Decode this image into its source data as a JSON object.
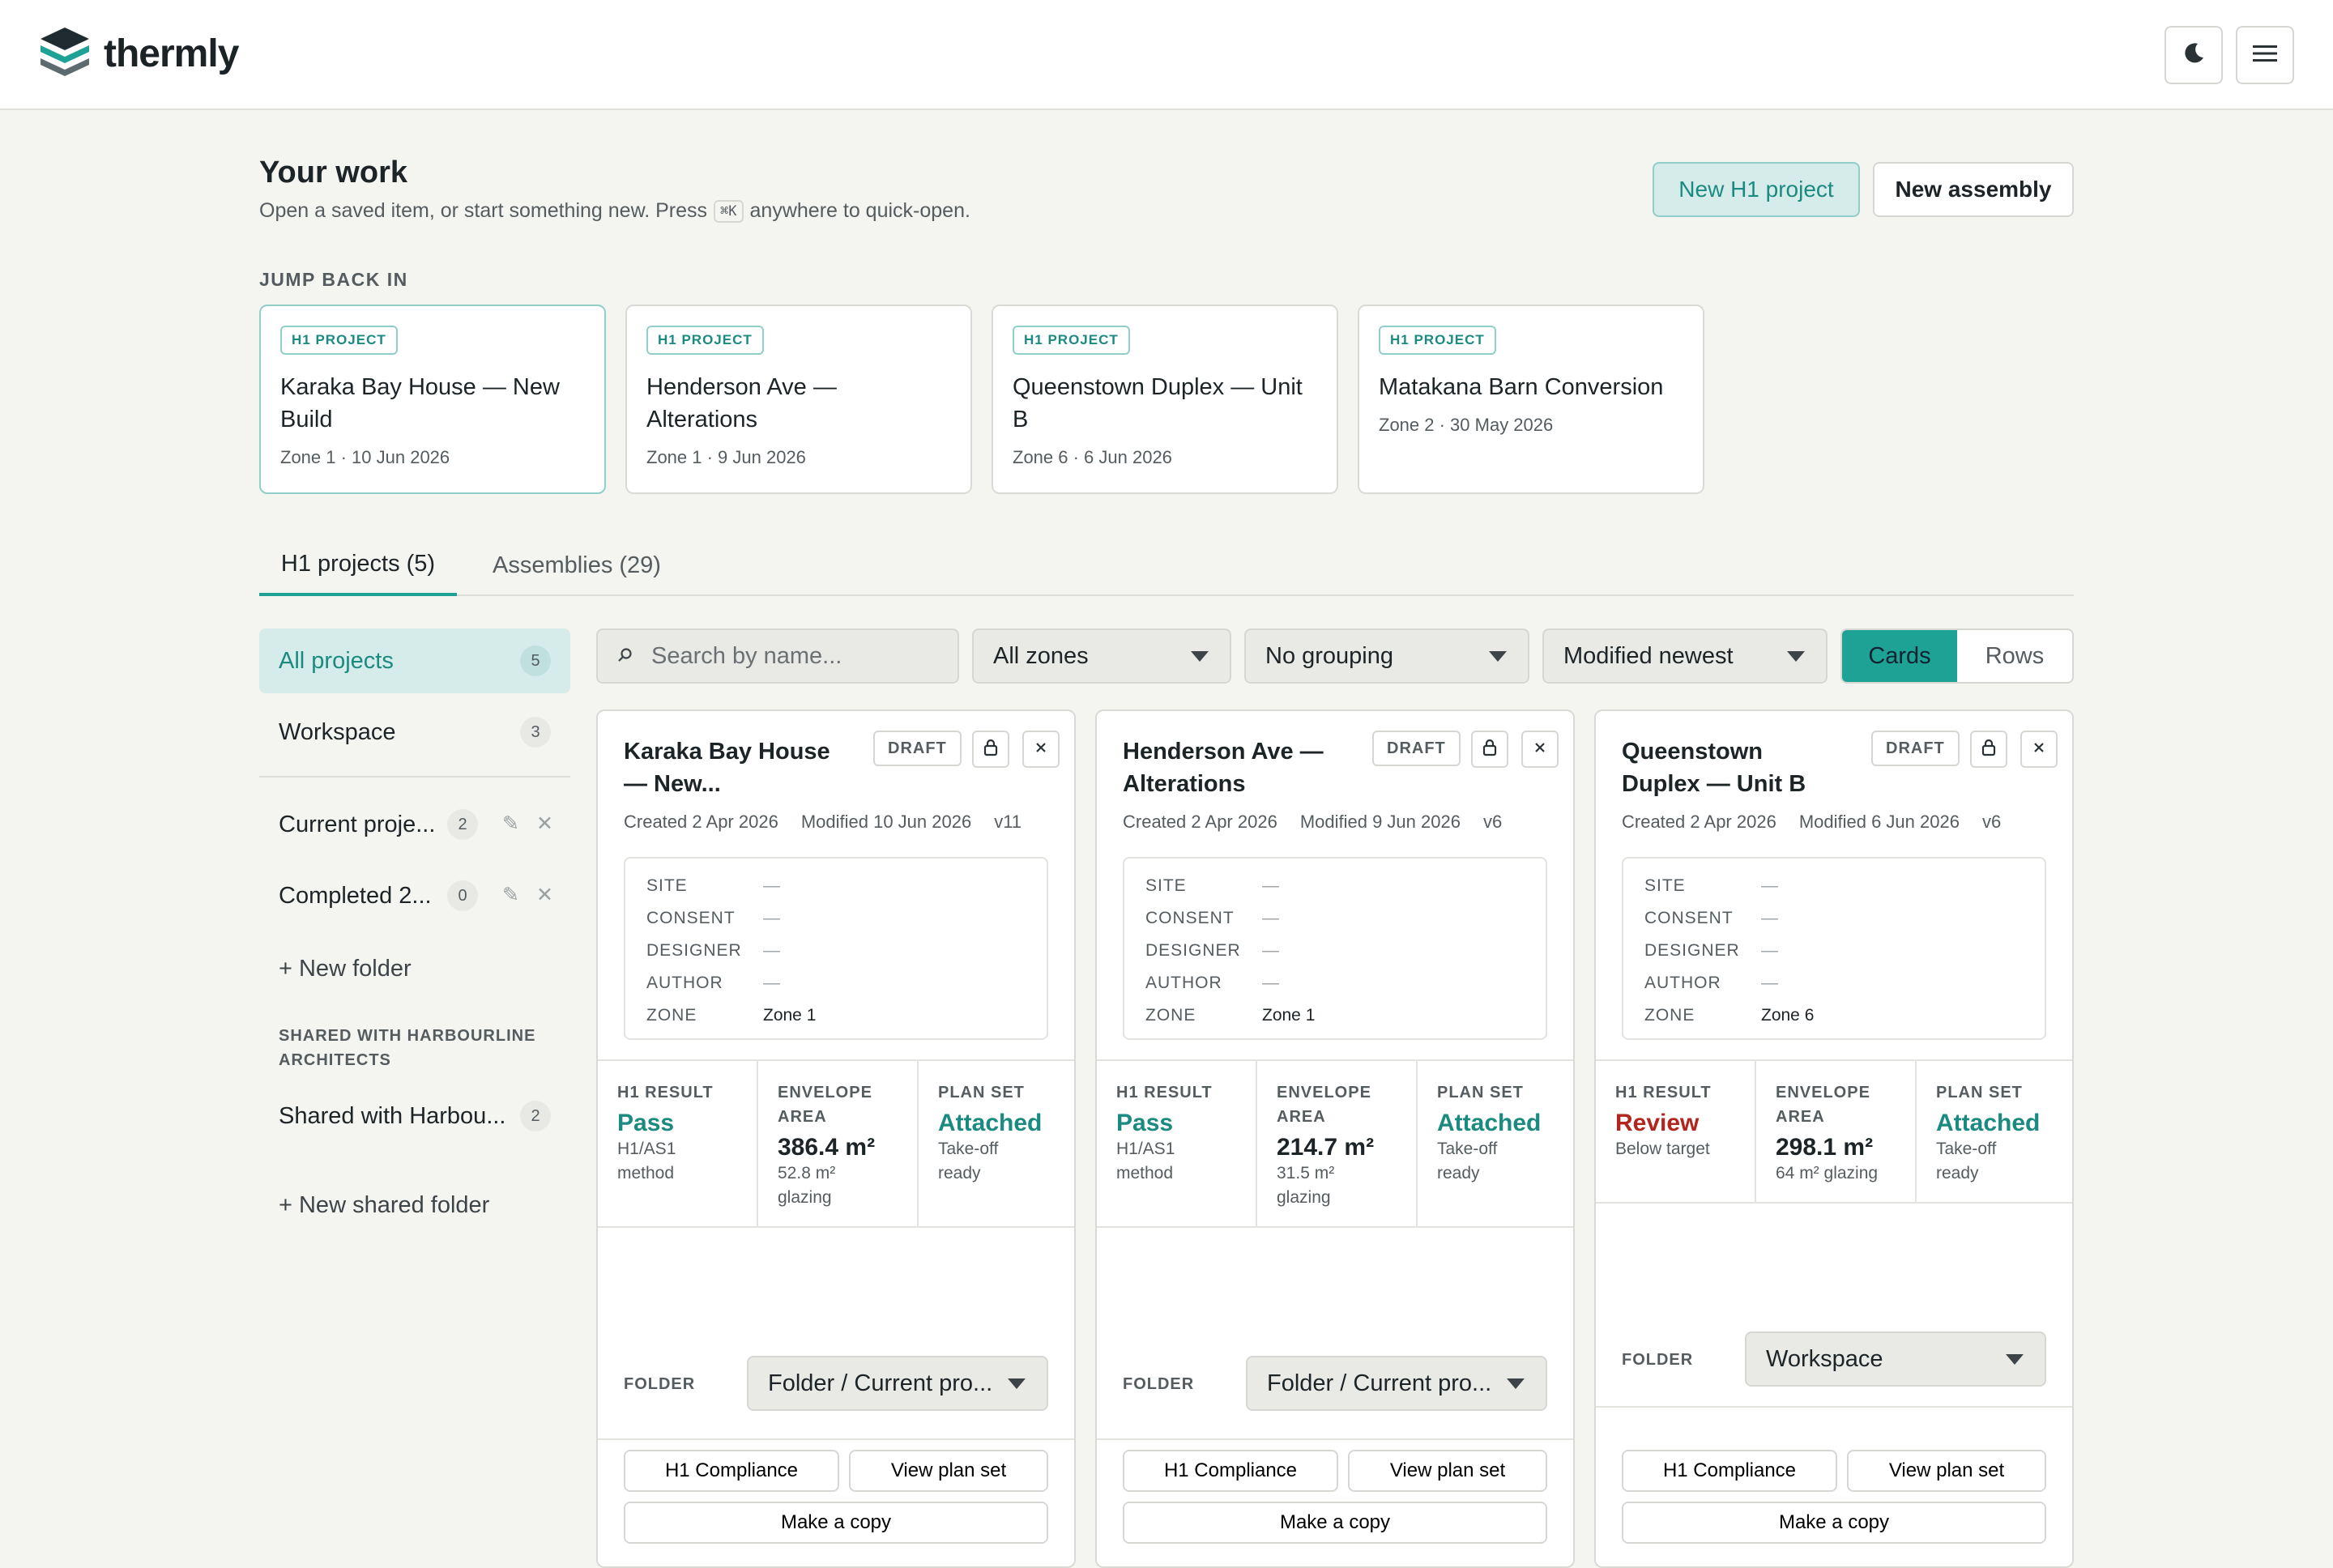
{
  "app": {
    "name": "thermly"
  },
  "page": {
    "title": "Your work",
    "subtitle_before": "Open a saved item, or start something new. Press",
    "shortcut": "⌘K",
    "subtitle_after": "anywhere to quick-open.",
    "new_project": "New H1 project",
    "new_assembly": "New assembly",
    "recent_label": "JUMP BACK IN"
  },
  "recent": [
    {
      "tag": "H1 PROJECT",
      "title": "Karaka Bay House — New Build",
      "meta": "Zone 1 · 10 Jun 2026"
    },
    {
      "tag": "H1 PROJECT",
      "title": "Henderson Ave — Alterations",
      "meta": "Zone 1 · 9 Jun 2026"
    },
    {
      "tag": "H1 PROJECT",
      "title": "Queenstown Duplex — Unit B",
      "meta": "Zone 6 · 6 Jun 2026"
    },
    {
      "tag": "H1 PROJECT",
      "title": "Matakana Barn Conversion",
      "meta": "Zone 2 · 30 May 2026"
    }
  ],
  "tabs": [
    {
      "label": "H1 projects (5)"
    },
    {
      "label": "Assemblies (29)"
    }
  ],
  "sidebar": {
    "items": [
      {
        "label": "All projects",
        "count": "5"
      },
      {
        "label": "Workspace",
        "count": "3"
      }
    ],
    "folders": [
      {
        "label": "Current proje...",
        "count": "2"
      },
      {
        "label": "Completed 2...",
        "count": "0"
      }
    ],
    "new_folder": "+ New folder",
    "shared_caption": "SHARED WITH HARBOURLINE ARCHITECTS",
    "shared_folder": {
      "label": "Shared with Harbou...",
      "count": "2"
    },
    "new_shared_folder": "+ New shared folder"
  },
  "toolbar": {
    "search_placeholder": "Search by name...",
    "zone_filter": "All zones",
    "grouping": "No grouping",
    "sort": "Modified newest",
    "view_cards": "Cards",
    "view_rows": "Rows"
  },
  "labels": {
    "draft": "DRAFT",
    "site": "SITE",
    "consent": "CONSENT",
    "designer": "DESIGNER",
    "author": "AUTHOR",
    "zone": "ZONE",
    "h1_result": "H1 RESULT",
    "envelope_area": "ENVELOPE AREA",
    "plan_set": "PLAN SET",
    "folder": "FOLDER",
    "h1_compliance": "H1 Compliance",
    "view_plan_set": "View plan set",
    "make_copy": "Make a copy"
  },
  "cards": [
    {
      "title": "Karaka Bay House — New...",
      "created": "Created 2 Apr 2026",
      "modified": "Modified 10 Jun 2026",
      "version": "v11",
      "site": "—",
      "consent": "—",
      "designer": "—",
      "author": "—",
      "zone": "Zone 1",
      "h1_result": "Pass",
      "h1_sub": "H1/AS1 method",
      "area": "386.4 m²",
      "area_sub": "52.8 m² glazing",
      "plan": "Attached",
      "plan_sub": "Take-off ready",
      "folder": "Folder / Current pro..."
    },
    {
      "title": "Henderson Ave — Alterations",
      "created": "Created 2 Apr 2026",
      "modified": "Modified 9 Jun 2026",
      "version": "v6",
      "site": "—",
      "consent": "—",
      "designer": "—",
      "author": "—",
      "zone": "Zone 1",
      "h1_result": "Pass",
      "h1_sub": "H1/AS1 method",
      "area": "214.7 m²",
      "area_sub": "31.5 m² glazing",
      "plan": "Attached",
      "plan_sub": "Take-off ready",
      "folder": "Folder / Current pro..."
    },
    {
      "title": "Queenstown Duplex — Unit B",
      "created": "Created 2 Apr 2026",
      "modified": "Modified 6 Jun 2026",
      "version": "v6",
      "site": "—",
      "consent": "—",
      "designer": "—",
      "author": "—",
      "zone": "Zone 6",
      "h1_result": "Review",
      "h1_sub": "Below target",
      "area": "298.1 m²",
      "area_sub": "64 m² glazing",
      "plan": "Attached",
      "plan_sub": "Take-off ready",
      "folder": "Workspace"
    }
  ],
  "colors": {
    "accent": "#1fa296",
    "accent_soft": "#d5ecea",
    "review": "#b3261e"
  }
}
